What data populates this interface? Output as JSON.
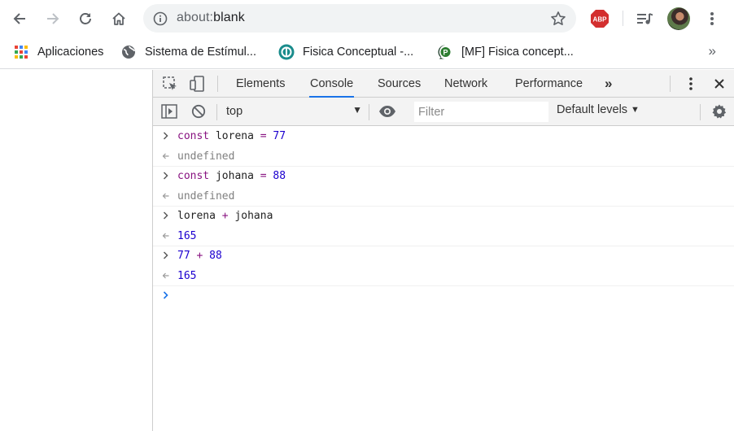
{
  "browser": {
    "url_scheme": "about:",
    "url_host": "blank",
    "colors": {
      "abp": "#d32f2f",
      "accent": "#1a73e8"
    }
  },
  "bookmarks": [
    {
      "label": "Aplicaciones",
      "icon": "apps-grid-icon"
    },
    {
      "label": "Sistema de Estímul...",
      "icon": "globe-icon"
    },
    {
      "label": "Fisica Conceptual -...",
      "icon": "teal-logo-icon"
    },
    {
      "label": "[MF] Fisica concept...",
      "icon": "green-logo-icon"
    }
  ],
  "bookmarks_more": "»",
  "devtools": {
    "tabs": [
      "Elements",
      "Console",
      "Sources",
      "Network",
      "Performance"
    ],
    "active_tab": "Console",
    "more_tabs": "»",
    "context": "top",
    "filter_placeholder": "Filter",
    "levels": "Default levels"
  },
  "console": [
    {
      "kind": "input",
      "parts": [
        [
          "kw",
          "const"
        ],
        [
          "txt",
          " lorena "
        ],
        [
          "kw",
          "="
        ],
        [
          "txt",
          " "
        ],
        [
          "num",
          "77"
        ]
      ]
    },
    {
      "kind": "output",
      "text": "undefined",
      "style": "res"
    },
    {
      "kind": "input",
      "parts": [
        [
          "kw",
          "const"
        ],
        [
          "txt",
          " johana "
        ],
        [
          "kw",
          "="
        ],
        [
          "txt",
          " "
        ],
        [
          "num",
          "88"
        ]
      ]
    },
    {
      "kind": "output",
      "text": "undefined",
      "style": "res"
    },
    {
      "kind": "input",
      "parts": [
        [
          "txt",
          "lorena "
        ],
        [
          "kw",
          "+"
        ],
        [
          "txt",
          " johana"
        ]
      ]
    },
    {
      "kind": "output",
      "text": "165",
      "style": "num-r"
    },
    {
      "kind": "input",
      "parts": [
        [
          "num",
          "77"
        ],
        [
          "txt",
          " "
        ],
        [
          "kw",
          "+"
        ],
        [
          "txt",
          " "
        ],
        [
          "num",
          "88"
        ]
      ]
    },
    {
      "kind": "output",
      "text": "165",
      "style": "num-r"
    }
  ]
}
